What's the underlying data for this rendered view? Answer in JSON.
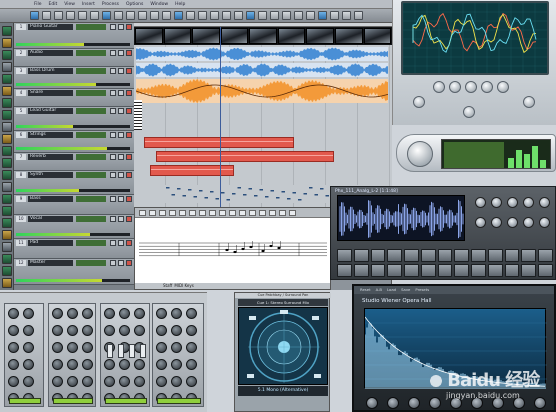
{
  "sequencer": {
    "menu": [
      "File",
      "Edit",
      "View",
      "Insert",
      "Process",
      "Options",
      "Window",
      "Help"
    ],
    "tracks": [
      {
        "name": "Piano Guitar",
        "num": "1",
        "meter": 0.6
      },
      {
        "name": "Audio",
        "num": "2",
        "meter": 0.4
      },
      {
        "name": "Bass Drum",
        "num": "3",
        "meter": 0.7
      },
      {
        "name": "Snare",
        "num": "4",
        "meter": 0.3
      },
      {
        "name": "Lead Guitar",
        "num": "5",
        "meter": 0.5
      },
      {
        "name": "Strings",
        "num": "6",
        "meter": 0.8
      },
      {
        "name": "Reverb",
        "num": "7",
        "meter": 0.2
      },
      {
        "name": "Synth",
        "num": "8",
        "meter": 0.55
      },
      {
        "name": "Bass",
        "num": "9",
        "meter": 0.45
      },
      {
        "name": "Vocal",
        "num": "10",
        "meter": 0.65
      },
      {
        "name": "Pad",
        "num": "11",
        "meter": 0.35
      },
      {
        "name": "Master",
        "num": "12",
        "meter": 0.75
      }
    ],
    "score_tabs": [
      "Staff",
      "MIDI Keys"
    ],
    "colors": {
      "audio_blue": "#4a8fd6",
      "audio_orange": "#f39a3a",
      "midi_red": "#e2594d"
    }
  },
  "sampler": {
    "title": "Phx_111_Analg_L-2 [1:1:48]",
    "label": "Timbre"
  },
  "surround": {
    "window_title": "Cue Patchbay / Surround Pan",
    "header": "Cue 1: Stereo Surround Mix",
    "readout": "5.1 Mono (Alternative)"
  },
  "reverb": {
    "menu": [
      "Reset",
      "A-B",
      "Load",
      "Save",
      "Presets"
    ],
    "title": "Studio Wiener Opera Hall"
  },
  "watermark": {
    "brand": "Baidu 经验",
    "url": "jingyan.baidu.com"
  }
}
